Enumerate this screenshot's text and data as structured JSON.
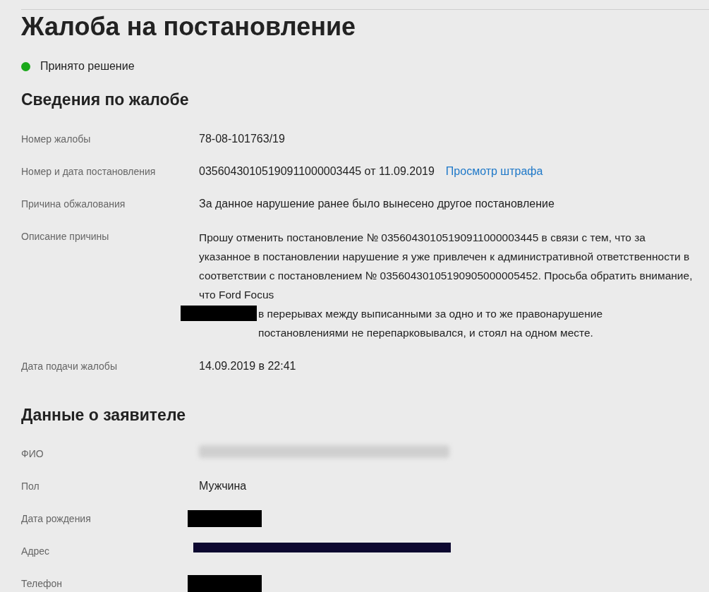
{
  "title": "Жалоба на постановление",
  "status": {
    "label": "Принято решение",
    "color": "#1aa81a"
  },
  "complaint": {
    "heading": "Сведения по жалобе",
    "rows": [
      {
        "label": "Номер жалобы",
        "kind": "text",
        "value": "78-08-101763/19"
      },
      {
        "label": "Номер и дата постановления",
        "kind": "link",
        "value": "03560430105190911000003445 от 11.09.2019",
        "link": "Просмотр штрафа"
      },
      {
        "label": "Причина обжалования",
        "kind": "text",
        "value": "За данное нарушение ранее было вынесено другое постановление"
      },
      {
        "label": "Описание причины",
        "kind": "redacted-text",
        "value": "Прошу отменить постановление № 03560430105190911000003445 в связи с тем, что за указанное в постановлении нарушение я уже привлечен к административной ответственности в соответствии с постановлением № 03560430105190905000005452. Просьба обратить внимание, что Ford Focus",
        "value_after": "в перерывах между выписанными за одно и то же правонарушение постановлениями не перепарковывался, и стоял на одном месте."
      },
      {
        "label": "Дата подачи жалобы",
        "kind": "text",
        "value": "14.09.2019 в 22:41"
      }
    ]
  },
  "applicant": {
    "heading": "Данные о заявителе",
    "rows": [
      {
        "label": "ФИО",
        "kind": "blurred"
      },
      {
        "label": "Пол",
        "kind": "text",
        "value": "Мужчина"
      },
      {
        "label": "Дата рождения",
        "kind": "redacted"
      },
      {
        "label": "Адрес",
        "kind": "redacted-line"
      },
      {
        "label": "Телефон",
        "kind": "redacted"
      }
    ]
  }
}
